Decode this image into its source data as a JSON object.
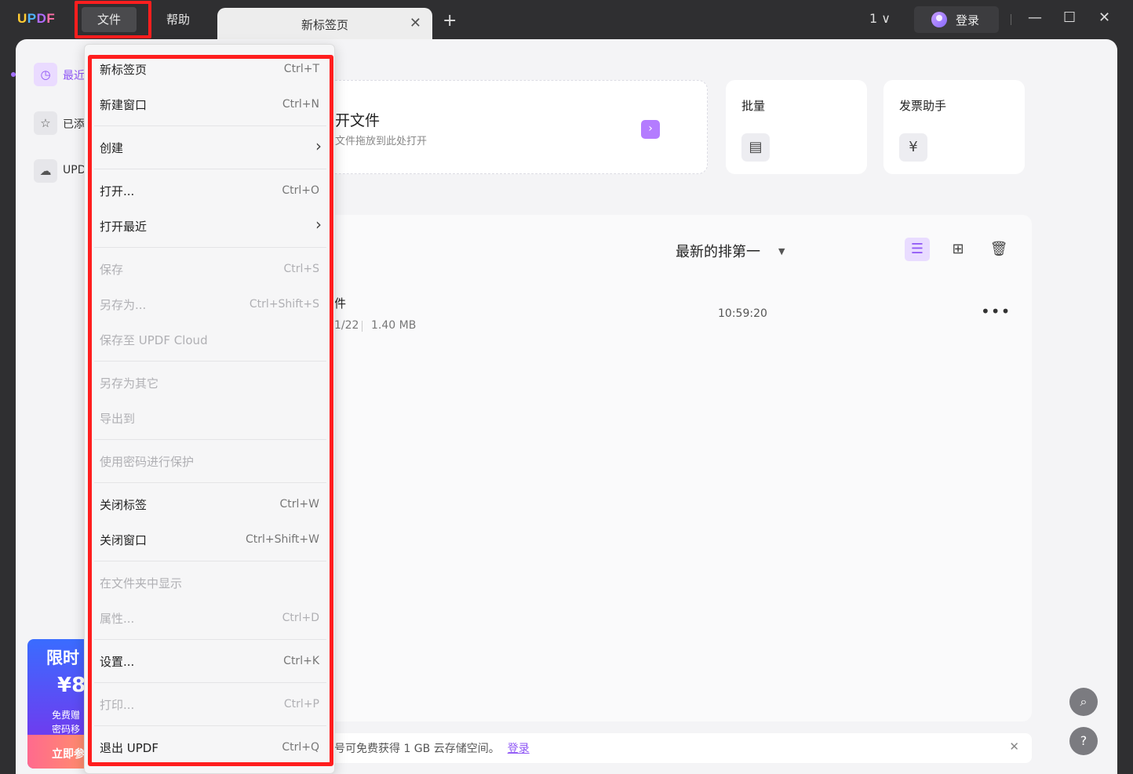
{
  "logo": {
    "l1": "U",
    "l2": "P",
    "l3": "D",
    "l4": "F"
  },
  "menubar": {
    "file": "文件",
    "help": "帮助"
  },
  "tab": {
    "label": "新标签页",
    "close": "✕"
  },
  "new_tab": "+",
  "page_num": "1 ∨",
  "login": "登录",
  "window": {
    "minimize": "—",
    "maximize": "☐",
    "close": "✕"
  },
  "sidebar": {
    "items": [
      {
        "icon": "clock-icon",
        "label": "最近"
      },
      {
        "icon": "star-icon",
        "label": "已添"
      },
      {
        "icon": "cloud-icon",
        "label": "UPD"
      }
    ]
  },
  "promo": {
    "line1": "限时",
    "line2": "¥8",
    "line3": "免费赠",
    "line4": "密码移",
    "button": "立即参"
  },
  "open_card": {
    "title": "开文件",
    "subtitle": "文件拖放到此处打开",
    "arrow": "›"
  },
  "cards": [
    {
      "title": "批量",
      "icon": "batch-icon"
    },
    {
      "title": "发票助手",
      "icon": "invoice-icon"
    }
  ],
  "list": {
    "sort_label": "最新的排第一",
    "file": {
      "name": "件",
      "date": "1/22",
      "size": "1.40 MB",
      "time": "10:59:20",
      "more": "•••"
    }
  },
  "banner": {
    "text": "号可免费获得 1 GB 云存储空间。",
    "link": "登录",
    "close": "✕"
  },
  "float": {
    "search": "⌕",
    "help": "?"
  },
  "file_menu": {
    "items": [
      {
        "label": "新标签页",
        "shortcut": "Ctrl+T"
      },
      {
        "label": "新建窗口",
        "shortcut": "Ctrl+N"
      },
      {
        "label": "创建",
        "shortcut": ""
      },
      {
        "label": "打开...",
        "shortcut": "Ctrl+O"
      },
      {
        "label": "打开最近",
        "shortcut": ""
      },
      {
        "label": "保存",
        "shortcut": "Ctrl+S"
      },
      {
        "label": "另存为...",
        "shortcut": "Ctrl+Shift+S"
      },
      {
        "label": "保存至 UPDF Cloud",
        "shortcut": ""
      },
      {
        "label": "另存为其它",
        "shortcut": ""
      },
      {
        "label": "导出到",
        "shortcut": ""
      },
      {
        "label": "使用密码进行保护",
        "shortcut": ""
      },
      {
        "label": "关闭标签",
        "shortcut": "Ctrl+W"
      },
      {
        "label": "关闭窗口",
        "shortcut": "Ctrl+Shift+W"
      },
      {
        "label": "在文件夹中显示",
        "shortcut": ""
      },
      {
        "label": "属性...",
        "shortcut": "Ctrl+D"
      },
      {
        "label": "设置...",
        "shortcut": "Ctrl+K"
      },
      {
        "label": "打印...",
        "shortcut": "Ctrl+P"
      },
      {
        "label": "退出 UPDF",
        "shortcut": "Ctrl+Q"
      }
    ],
    "submenu_arrow": "›"
  },
  "colors": {
    "accent": "#8e55f5",
    "highlight": "#ff1e1e"
  }
}
